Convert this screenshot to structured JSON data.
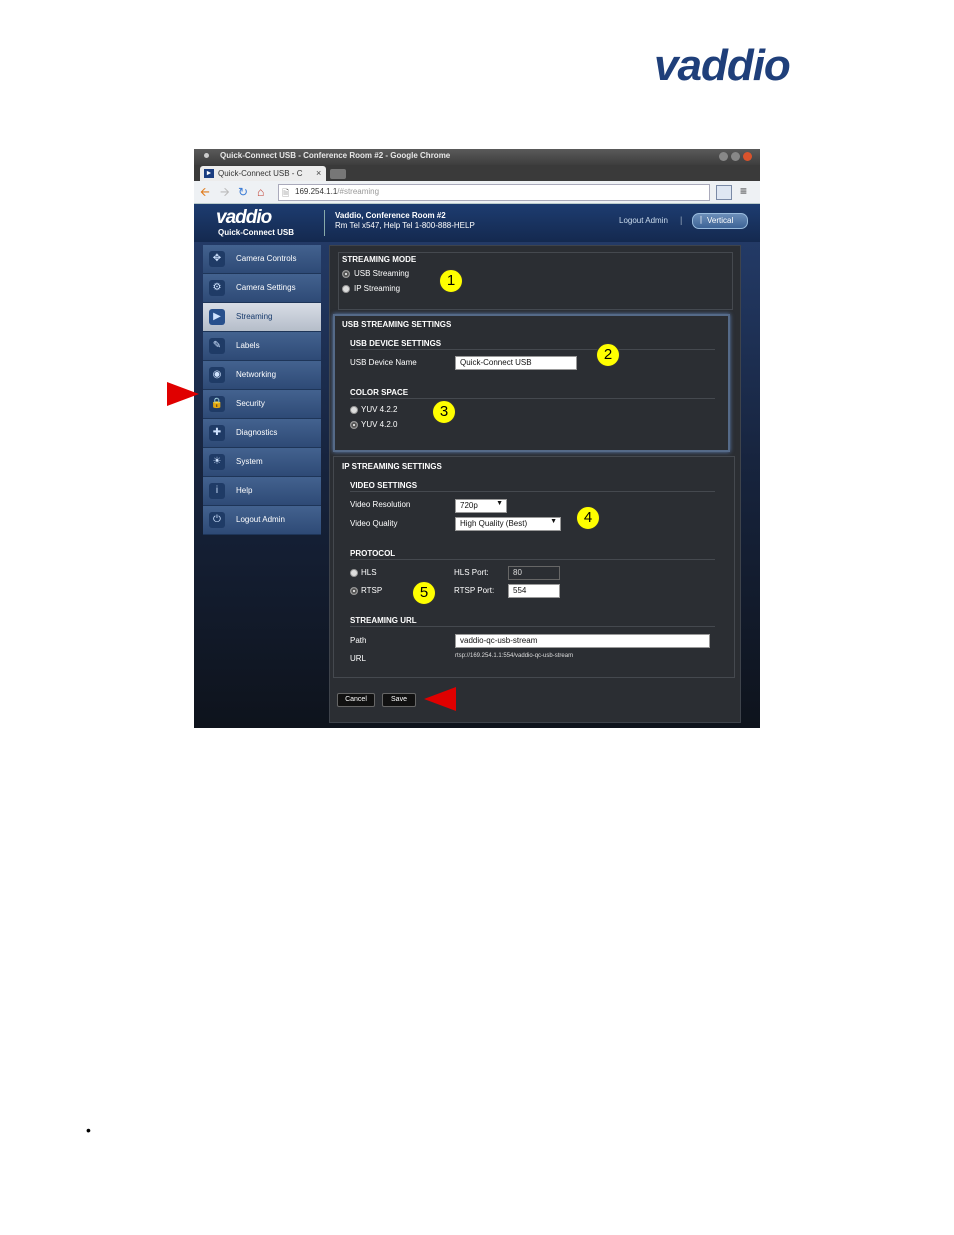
{
  "page": {
    "logo_text": "vaddio",
    "bullet": "•"
  },
  "browser": {
    "window_title": "Quick-Connect USB - Conference Room #2 - Google Chrome",
    "tab_title": "Quick-Connect USB - C",
    "tab_close": "×",
    "url_host": "169.254.1.1",
    "url_path": "/#streaming"
  },
  "app": {
    "logo": "vaddio",
    "product": "Quick-Connect USB",
    "room": "Vaddio, Conference Room #2",
    "tel": "Rm Tel x547, Help Tel 1-800-888-HELP",
    "logout": "Logout Admin",
    "separator": "|",
    "vertical_button": "Vertical"
  },
  "sidebar": {
    "items": [
      {
        "label": "Camera Controls",
        "icon": "camera-controls-icon",
        "active": false
      },
      {
        "label": "Camera Settings",
        "icon": "camera-settings-icon",
        "active": false
      },
      {
        "label": "Streaming",
        "icon": "streaming-icon",
        "active": true
      },
      {
        "label": "Labels",
        "icon": "labels-icon",
        "active": false
      },
      {
        "label": "Networking",
        "icon": "networking-icon",
        "active": false
      },
      {
        "label": "Security",
        "icon": "security-icon",
        "active": false
      },
      {
        "label": "Diagnostics",
        "icon": "diagnostics-icon",
        "active": false
      },
      {
        "label": "System",
        "icon": "system-icon",
        "active": false
      },
      {
        "label": "Help",
        "icon": "help-icon",
        "active": false
      },
      {
        "label": "Logout Admin",
        "icon": "power-icon",
        "active": false
      }
    ]
  },
  "streaming_mode": {
    "heading": "STREAMING MODE",
    "options": [
      "USB Streaming",
      "IP Streaming"
    ],
    "selected": "USB Streaming"
  },
  "usb_settings": {
    "heading": "USB STREAMING SETTINGS",
    "device_heading": "USB DEVICE SETTINGS",
    "device_name_label": "USB Device Name",
    "device_name_value": "Quick-Connect USB",
    "color_heading": "COLOR SPACE",
    "color_options": [
      "YUV 4.2.2",
      "YUV 4.2.0"
    ],
    "color_selected": "YUV 4.2.0"
  },
  "ip_settings": {
    "heading": "IP STREAMING SETTINGS",
    "video_heading": "VIDEO SETTINGS",
    "resolution_label": "Video Resolution",
    "resolution_value": "720p",
    "quality_label": "Video Quality",
    "quality_value": "High Quality (Best)",
    "protocol_heading": "PROTOCOL",
    "protocol_options": [
      "HLS",
      "RTSP"
    ],
    "protocol_selected": "RTSP",
    "hls_port_label": "HLS Port:",
    "hls_port_value": "80",
    "rtsp_port_label": "RTSP Port:",
    "rtsp_port_value": "554",
    "url_heading": "STREAMING URL",
    "path_label": "Path",
    "path_value": "vaddio-qc-usb-stream",
    "url_label": "URL",
    "url_value": "rtsp://169.254.1.1:554/vaddio-qc-usb-stream"
  },
  "buttons": {
    "cancel": "Cancel",
    "save": "Save"
  },
  "callouts": [
    "1",
    "2",
    "3",
    "4",
    "5"
  ],
  "colors": {
    "callout": "#ffff00",
    "arrow": "#e00000",
    "brand": "#1f3f7a"
  }
}
